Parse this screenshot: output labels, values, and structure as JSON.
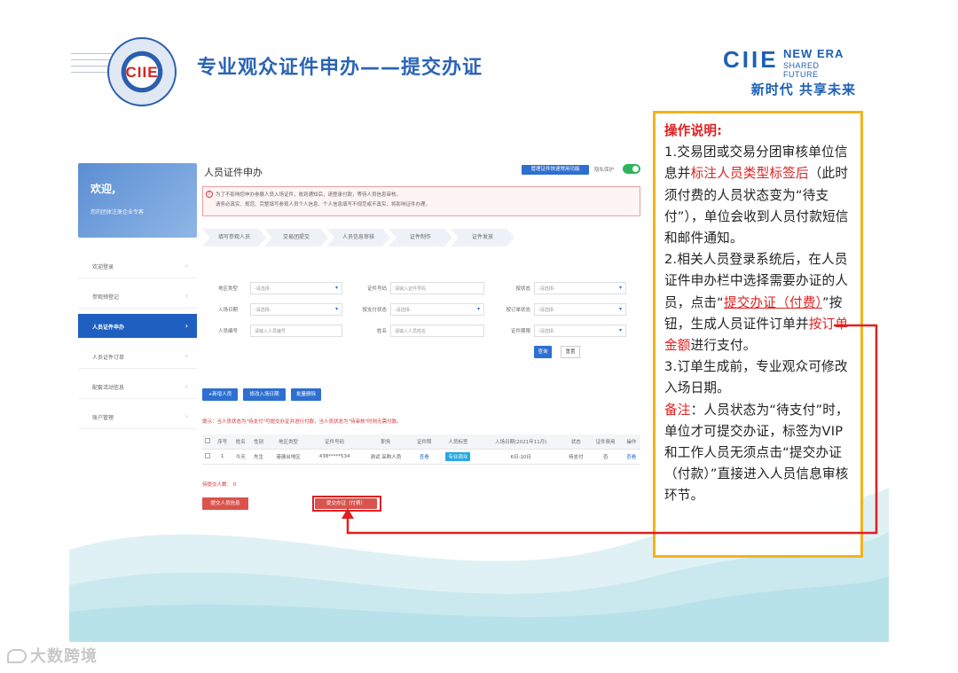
{
  "slide": {
    "title": "专业观众证件申办——提交办证",
    "seal_text": "CIIE",
    "brand_ciie": "CIIE",
    "brand_new_era": "NEW ERA",
    "brand_shared_future": "SHARED FUTURE",
    "brand_cn": "新时代 共享未来",
    "watermark": "大数跨境"
  },
  "sidebar": {
    "welcome": "欢迎,",
    "welcome_sub": "您的团体注册企业专客",
    "items": [
      {
        "label": "欢迎登录"
      },
      {
        "label": "参观预登记"
      },
      {
        "label": "人员证件申办",
        "active": true
      },
      {
        "label": "人员证件订单"
      },
      {
        "label": "配套活动信息"
      },
      {
        "label": "账户管理"
      }
    ]
  },
  "main": {
    "title": "人员证件申办",
    "top_button": "管理证件快速常用功能",
    "privacy_label": "隐私保护",
    "notice_line1": "为了不影响您申办参展人员入场证件，收到通知后，请登录付款，等待人员信息审核。",
    "notice_line2": "请务必真实、规范、完整填写参观人员个人信息、个人信息填写不规范或不真实，将影响证件办理。",
    "steps": [
      "填写参观人员",
      "交易团提交",
      "人员信息审核",
      "证件制作",
      "证件发放"
    ],
    "form": {
      "region_type": {
        "label": "地区类型",
        "value": "-请选择-"
      },
      "cert_no": {
        "label": "证件号码",
        "placeholder": "请输入证件号码"
      },
      "status": {
        "label": "按状态",
        "value": "-请选择-"
      },
      "entry_date": {
        "label": "入场日期",
        "value": "-请选择-"
      },
      "pay_status": {
        "label": "按支付状态",
        "value": "-请选择-"
      },
      "order_status": {
        "label": "按订单状态",
        "value": "-请选择-"
      },
      "person_no": {
        "label": "人员编号",
        "placeholder": "请输入人员编号"
      },
      "name": {
        "label": "姓名",
        "placeholder": "请输入人员姓名"
      },
      "cert_use": {
        "label": "证件期限",
        "value": "-请选择-"
      },
      "query_button": "查询",
      "reset_button": "重置"
    },
    "actions": [
      "+新增人员",
      "修改入场日期",
      "批量删除"
    ],
    "tip": "提示：当人员状态为\"待支付\"可提交办证并进行付款，当人员状态为\"待审核\"时则无需付款。",
    "table": {
      "headers": [
        "",
        "序号",
        "姓名",
        "性别",
        "地区类型",
        "证件号码",
        "职务",
        "证件照",
        "人员标签",
        "入场日期(2021年11月)",
        "状态",
        "证件费用",
        "操作"
      ],
      "rows": [
        [
          "",
          "1",
          "今天",
          "先生",
          "港澳台地区",
          "438*****534",
          "测试 采购人员",
          "查看",
          "专业观众",
          "6日-10日",
          "待支付",
          "否",
          "查看"
        ]
      ]
    },
    "pending_count": "待提交人数： 0",
    "submit_info_button": "提交人员信息",
    "submit_cert_button": "提交办证（付费）"
  },
  "instructions": {
    "heading": "操作说明:",
    "p1_a": "1.交易团或交易分团审核单位信息并",
    "p1_red": "标注人员类型标签后",
    "p1_b": "（此时须付费的人员状态变为“待支付”），单位会收到人员付款短信和邮件通知。",
    "p2_a": "2.相关人员登录系统后，在人员证件申办栏中选择需要办证的人员，点击“",
    "p2_hl": "提交办证（付费）",
    "p2_b": "”按钮，生成人员证件订单并",
    "p2_red": "按订单金额",
    "p2_c": "进行支付。",
    "p3": "3.订单生成前，专业观众可修改入场日期。",
    "note_label": "备注",
    "note_text": "：人员状态为“待支付”时，单位才可提交办证，标签为VIP和工作人员无须点击“提交办证（付款）”直接进入人员信息审核环节。"
  },
  "colors": {
    "brand_blue": "#1d5fb6",
    "highlight_red": "#e02020",
    "box_border": "#f3b31b",
    "active_nav": "#1f5fbf"
  }
}
